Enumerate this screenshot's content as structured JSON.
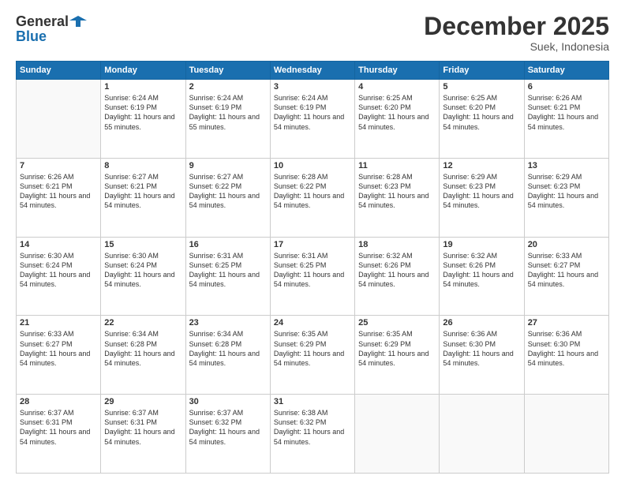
{
  "logo": {
    "general": "General",
    "blue": "Blue"
  },
  "header": {
    "month": "December 2025",
    "location": "Suek, Indonesia"
  },
  "days": [
    "Sunday",
    "Monday",
    "Tuesday",
    "Wednesday",
    "Thursday",
    "Friday",
    "Saturday"
  ],
  "weeks": [
    [
      {
        "day": "",
        "sunrise": "",
        "sunset": "",
        "daylight": ""
      },
      {
        "day": "1",
        "sunrise": "Sunrise: 6:24 AM",
        "sunset": "Sunset: 6:19 PM",
        "daylight": "Daylight: 11 hours and 55 minutes."
      },
      {
        "day": "2",
        "sunrise": "Sunrise: 6:24 AM",
        "sunset": "Sunset: 6:19 PM",
        "daylight": "Daylight: 11 hours and 55 minutes."
      },
      {
        "day": "3",
        "sunrise": "Sunrise: 6:24 AM",
        "sunset": "Sunset: 6:19 PM",
        "daylight": "Daylight: 11 hours and 54 minutes."
      },
      {
        "day": "4",
        "sunrise": "Sunrise: 6:25 AM",
        "sunset": "Sunset: 6:20 PM",
        "daylight": "Daylight: 11 hours and 54 minutes."
      },
      {
        "day": "5",
        "sunrise": "Sunrise: 6:25 AM",
        "sunset": "Sunset: 6:20 PM",
        "daylight": "Daylight: 11 hours and 54 minutes."
      },
      {
        "day": "6",
        "sunrise": "Sunrise: 6:26 AM",
        "sunset": "Sunset: 6:21 PM",
        "daylight": "Daylight: 11 hours and 54 minutes."
      }
    ],
    [
      {
        "day": "7",
        "sunrise": "Sunrise: 6:26 AM",
        "sunset": "Sunset: 6:21 PM",
        "daylight": "Daylight: 11 hours and 54 minutes."
      },
      {
        "day": "8",
        "sunrise": "Sunrise: 6:27 AM",
        "sunset": "Sunset: 6:21 PM",
        "daylight": "Daylight: 11 hours and 54 minutes."
      },
      {
        "day": "9",
        "sunrise": "Sunrise: 6:27 AM",
        "sunset": "Sunset: 6:22 PM",
        "daylight": "Daylight: 11 hours and 54 minutes."
      },
      {
        "day": "10",
        "sunrise": "Sunrise: 6:28 AM",
        "sunset": "Sunset: 6:22 PM",
        "daylight": "Daylight: 11 hours and 54 minutes."
      },
      {
        "day": "11",
        "sunrise": "Sunrise: 6:28 AM",
        "sunset": "Sunset: 6:23 PM",
        "daylight": "Daylight: 11 hours and 54 minutes."
      },
      {
        "day": "12",
        "sunrise": "Sunrise: 6:29 AM",
        "sunset": "Sunset: 6:23 PM",
        "daylight": "Daylight: 11 hours and 54 minutes."
      },
      {
        "day": "13",
        "sunrise": "Sunrise: 6:29 AM",
        "sunset": "Sunset: 6:23 PM",
        "daylight": "Daylight: 11 hours and 54 minutes."
      }
    ],
    [
      {
        "day": "14",
        "sunrise": "Sunrise: 6:30 AM",
        "sunset": "Sunset: 6:24 PM",
        "daylight": "Daylight: 11 hours and 54 minutes."
      },
      {
        "day": "15",
        "sunrise": "Sunrise: 6:30 AM",
        "sunset": "Sunset: 6:24 PM",
        "daylight": "Daylight: 11 hours and 54 minutes."
      },
      {
        "day": "16",
        "sunrise": "Sunrise: 6:31 AM",
        "sunset": "Sunset: 6:25 PM",
        "daylight": "Daylight: 11 hours and 54 minutes."
      },
      {
        "day": "17",
        "sunrise": "Sunrise: 6:31 AM",
        "sunset": "Sunset: 6:25 PM",
        "daylight": "Daylight: 11 hours and 54 minutes."
      },
      {
        "day": "18",
        "sunrise": "Sunrise: 6:32 AM",
        "sunset": "Sunset: 6:26 PM",
        "daylight": "Daylight: 11 hours and 54 minutes."
      },
      {
        "day": "19",
        "sunrise": "Sunrise: 6:32 AM",
        "sunset": "Sunset: 6:26 PM",
        "daylight": "Daylight: 11 hours and 54 minutes."
      },
      {
        "day": "20",
        "sunrise": "Sunrise: 6:33 AM",
        "sunset": "Sunset: 6:27 PM",
        "daylight": "Daylight: 11 hours and 54 minutes."
      }
    ],
    [
      {
        "day": "21",
        "sunrise": "Sunrise: 6:33 AM",
        "sunset": "Sunset: 6:27 PM",
        "daylight": "Daylight: 11 hours and 54 minutes."
      },
      {
        "day": "22",
        "sunrise": "Sunrise: 6:34 AM",
        "sunset": "Sunset: 6:28 PM",
        "daylight": "Daylight: 11 hours and 54 minutes."
      },
      {
        "day": "23",
        "sunrise": "Sunrise: 6:34 AM",
        "sunset": "Sunset: 6:28 PM",
        "daylight": "Daylight: 11 hours and 54 minutes."
      },
      {
        "day": "24",
        "sunrise": "Sunrise: 6:35 AM",
        "sunset": "Sunset: 6:29 PM",
        "daylight": "Daylight: 11 hours and 54 minutes."
      },
      {
        "day": "25",
        "sunrise": "Sunrise: 6:35 AM",
        "sunset": "Sunset: 6:29 PM",
        "daylight": "Daylight: 11 hours and 54 minutes."
      },
      {
        "day": "26",
        "sunrise": "Sunrise: 6:36 AM",
        "sunset": "Sunset: 6:30 PM",
        "daylight": "Daylight: 11 hours and 54 minutes."
      },
      {
        "day": "27",
        "sunrise": "Sunrise: 6:36 AM",
        "sunset": "Sunset: 6:30 PM",
        "daylight": "Daylight: 11 hours and 54 minutes."
      }
    ],
    [
      {
        "day": "28",
        "sunrise": "Sunrise: 6:37 AM",
        "sunset": "Sunset: 6:31 PM",
        "daylight": "Daylight: 11 hours and 54 minutes."
      },
      {
        "day": "29",
        "sunrise": "Sunrise: 6:37 AM",
        "sunset": "Sunset: 6:31 PM",
        "daylight": "Daylight: 11 hours and 54 minutes."
      },
      {
        "day": "30",
        "sunrise": "Sunrise: 6:37 AM",
        "sunset": "Sunset: 6:32 PM",
        "daylight": "Daylight: 11 hours and 54 minutes."
      },
      {
        "day": "31",
        "sunrise": "Sunrise: 6:38 AM",
        "sunset": "Sunset: 6:32 PM",
        "daylight": "Daylight: 11 hours and 54 minutes."
      },
      {
        "day": "",
        "sunrise": "",
        "sunset": "",
        "daylight": ""
      },
      {
        "day": "",
        "sunrise": "",
        "sunset": "",
        "daylight": ""
      },
      {
        "day": "",
        "sunrise": "",
        "sunset": "",
        "daylight": ""
      }
    ]
  ]
}
